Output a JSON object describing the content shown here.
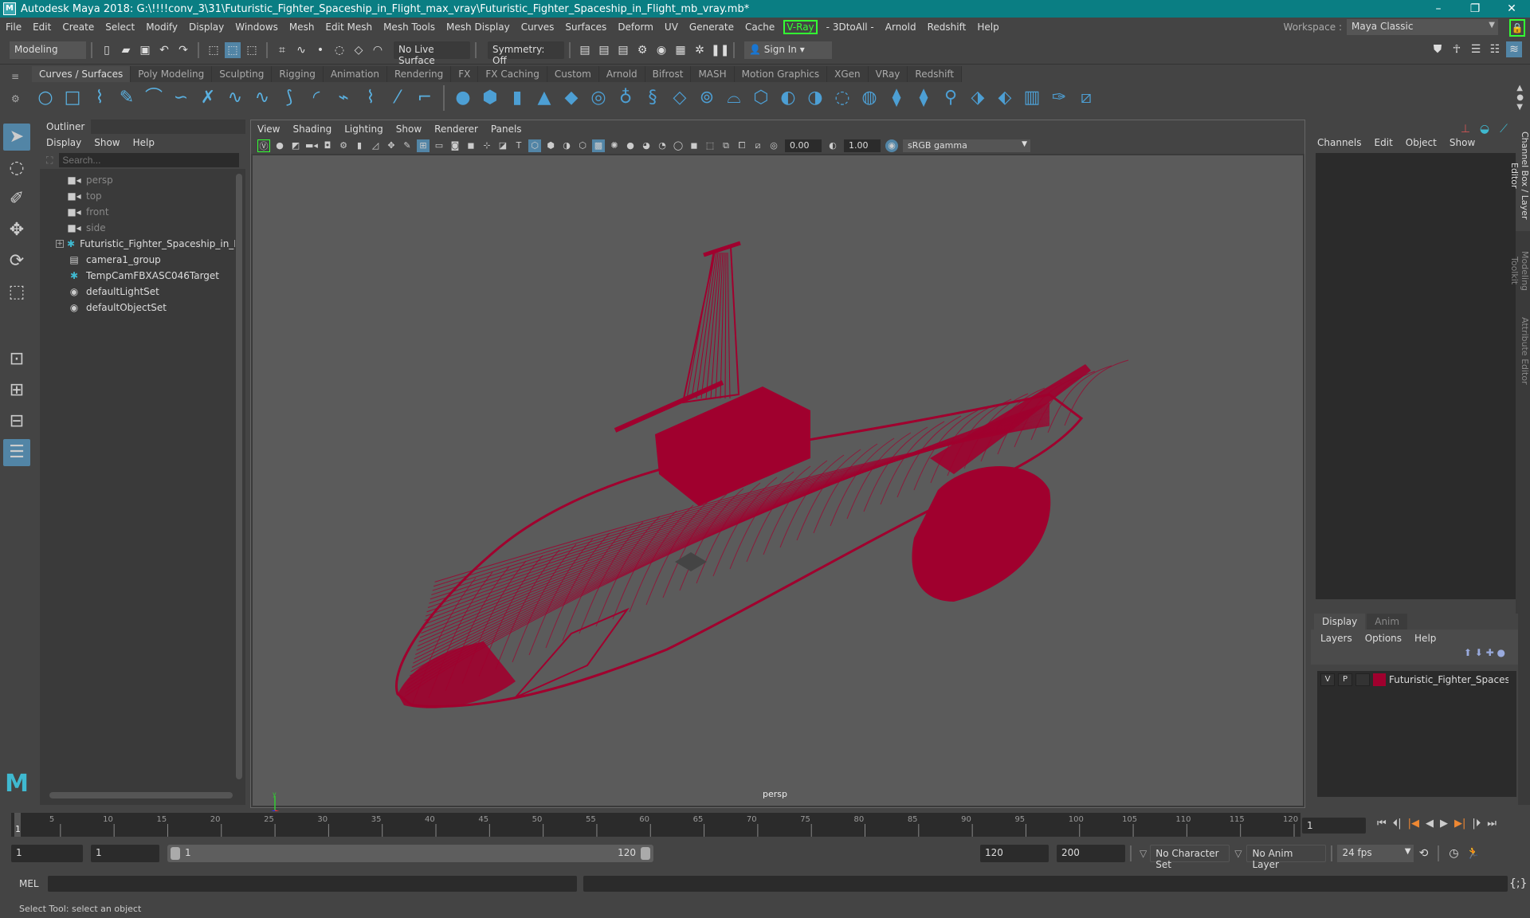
{
  "window": {
    "title": "Autodesk Maya 2018: G:\\!!!!conv_3\\31\\Futuristic_Fighter_Spaceship_in_Flight_max_vray\\Futuristic_Fighter_Spaceship_in_Flight_mb_vray.mb*",
    "logo": "M"
  },
  "menubar": {
    "items": [
      "File",
      "Edit",
      "Create",
      "Select",
      "Modify",
      "Display",
      "Windows",
      "Mesh",
      "Edit Mesh",
      "Mesh Tools",
      "Mesh Display",
      "Curves",
      "Surfaces",
      "Deform",
      "UV",
      "Generate",
      "Cache"
    ],
    "vray": "V-Ray",
    "items2": [
      "- 3DtoAll -",
      "Arnold",
      "Redshift",
      "Help"
    ],
    "workspace_label": "Workspace :",
    "workspace_value": "Maya Classic"
  },
  "statusline": {
    "mode": "Modeling",
    "live_surface": "No Live Surface",
    "symmetry": "Symmetry: Off",
    "sign_in": "Sign In"
  },
  "shelf": {
    "tabs": [
      "Curves / Surfaces",
      "Poly Modeling",
      "Sculpting",
      "Rigging",
      "Animation",
      "Rendering",
      "FX",
      "FX Caching",
      "Custom",
      "Arnold",
      "Bifrost",
      "MASH",
      "Motion Graphics",
      "XGen",
      "VRay",
      "Redshift"
    ],
    "active_tab": 0
  },
  "outliner": {
    "title": "Outliner",
    "menu": [
      "Display",
      "Show",
      "Help"
    ],
    "search_placeholder": "Search...",
    "items": [
      {
        "label": "persp",
        "icon": "camera-icon",
        "dim": true
      },
      {
        "label": "top",
        "icon": "camera-icon",
        "dim": true
      },
      {
        "label": "front",
        "icon": "camera-icon",
        "dim": true
      },
      {
        "label": "side",
        "icon": "camera-icon",
        "dim": true
      },
      {
        "label": "Futuristic_Fighter_Spaceship_in_Flight",
        "icon": "group-star-icon",
        "expandable": true
      },
      {
        "label": "camera1_group",
        "icon": "group-icon"
      },
      {
        "label": "TempCamFBXASC046Target",
        "icon": "locator-icon"
      },
      {
        "label": "defaultLightSet",
        "icon": "set-icon"
      },
      {
        "label": "defaultObjectSet",
        "icon": "set-icon"
      }
    ]
  },
  "viewport": {
    "menu": [
      "View",
      "Shading",
      "Lighting",
      "Show",
      "Renderer",
      "Panels"
    ],
    "exposure": "0.00",
    "gamma": "1.00",
    "color_space": "sRGB gamma",
    "camera_label": "persp",
    "wire_color": "#a0002e"
  },
  "channelbox": {
    "menu": [
      "Channels",
      "Edit",
      "Object",
      "Show"
    ]
  },
  "sidetabs": [
    "Channel Box / Layer Editor",
    "Modeling Toolkit",
    "Attribute Editor"
  ],
  "layers": {
    "tabs": [
      "Display",
      "Anim"
    ],
    "menu": [
      "Layers",
      "Options",
      "Help"
    ],
    "rows": [
      {
        "v": "V",
        "p": "P",
        "color": "#a0002e",
        "name": "Futuristic_Fighter_Spaceship_in_Flight"
      }
    ]
  },
  "timeline": {
    "ticks": [
      "5",
      "10",
      "15",
      "20",
      "25",
      "30",
      "35",
      "40",
      "45",
      "50",
      "55",
      "60",
      "65",
      "70",
      "75",
      "80",
      "85",
      "90",
      "95",
      "100",
      "105",
      "110",
      "115",
      "120"
    ],
    "start": 1,
    "end": 120,
    "current_frame": "1",
    "current_marker": "1"
  },
  "range": {
    "start_field": "1",
    "playback_start": "1",
    "slider_start": "1",
    "slider_end": "120",
    "playback_end": "120",
    "end_field": "200",
    "character_set": "No Character Set",
    "anim_layer": "No Anim Layer",
    "fps": "24 fps"
  },
  "cmdline": {
    "label": "MEL"
  },
  "helpline": {
    "text": "Select Tool: select an object"
  }
}
